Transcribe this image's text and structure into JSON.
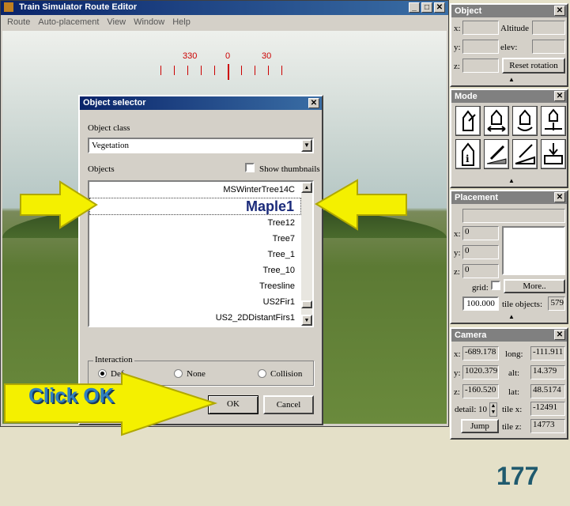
{
  "app": {
    "title": "Train Simulator Route Editor",
    "menu": [
      "Route",
      "Auto-placement",
      "View",
      "Window",
      "Help"
    ]
  },
  "compass": {
    "ticks": [
      "330",
      "0",
      "30"
    ]
  },
  "object_panel": {
    "title": "Object",
    "x_label": "x:",
    "y_label": "y:",
    "z_label": "z:",
    "altitude_label": "Altitude",
    "elev_label": "elev:",
    "reset_rotation": "Reset rotation"
  },
  "mode_panel": {
    "title": "Mode",
    "icons": [
      "select-mode-icon",
      "move-mode-icon",
      "rotate-mode-icon",
      "elevate-mode-icon",
      "info-mode-icon",
      "terrain-paint-icon",
      "terrain-pen-icon",
      "terrain-raise-icon"
    ]
  },
  "placement_panel": {
    "title": "Placement",
    "x_label": "x:",
    "x_value": "0",
    "y_label": "y:",
    "y_value": "0",
    "z_label": "z:",
    "z_value": "0",
    "grid_label": "grid:",
    "more_button": "More..",
    "grid_value": "100.000",
    "tile_objects_label": "tile objects:",
    "tile_objects_value": "579"
  },
  "camera_panel": {
    "title": "Camera",
    "x_label": "x:",
    "x_value": "-689.178",
    "y_label": "y:",
    "y_value": "1020.379",
    "z_label": "z:",
    "z_value": "-160.520",
    "long_label": "long:",
    "long_value": "-111.911",
    "alt_label": "alt:",
    "alt_value": "14.379",
    "lat_label": "lat:",
    "lat_value": "48.5174",
    "detail_label": "detail:",
    "detail_value": "10",
    "tile_x_label": "tile x:",
    "tile_x_value": "-12491",
    "tile_z_label": "tile z:",
    "tile_z_value": "14773",
    "jump_button": "Jump"
  },
  "dialog": {
    "title": "Object selector",
    "object_class_label": "Object class",
    "object_class_value": "Vegetation",
    "objects_label": "Objects",
    "show_thumbnails": "Show thumbnails",
    "items": [
      "MSWinterTree14C",
      "Maple1",
      "Tree12",
      "Tree7",
      "Tree_1",
      "Tree_10",
      "Treesline",
      "US2Fir1",
      "US2_2DDistantFirs1"
    ],
    "selected": "Maple1",
    "interaction_label": "Interaction",
    "interaction_options": [
      "Def",
      "None",
      "Collision"
    ],
    "ok_button": "OK",
    "cancel_button": "Cancel"
  },
  "callout": {
    "click_ok": "Click OK"
  },
  "page_number": "177",
  "colors": {
    "arrow": "#f4f000",
    "callout_text": "#2f7fc0",
    "page_number": "#1f5a6e"
  }
}
